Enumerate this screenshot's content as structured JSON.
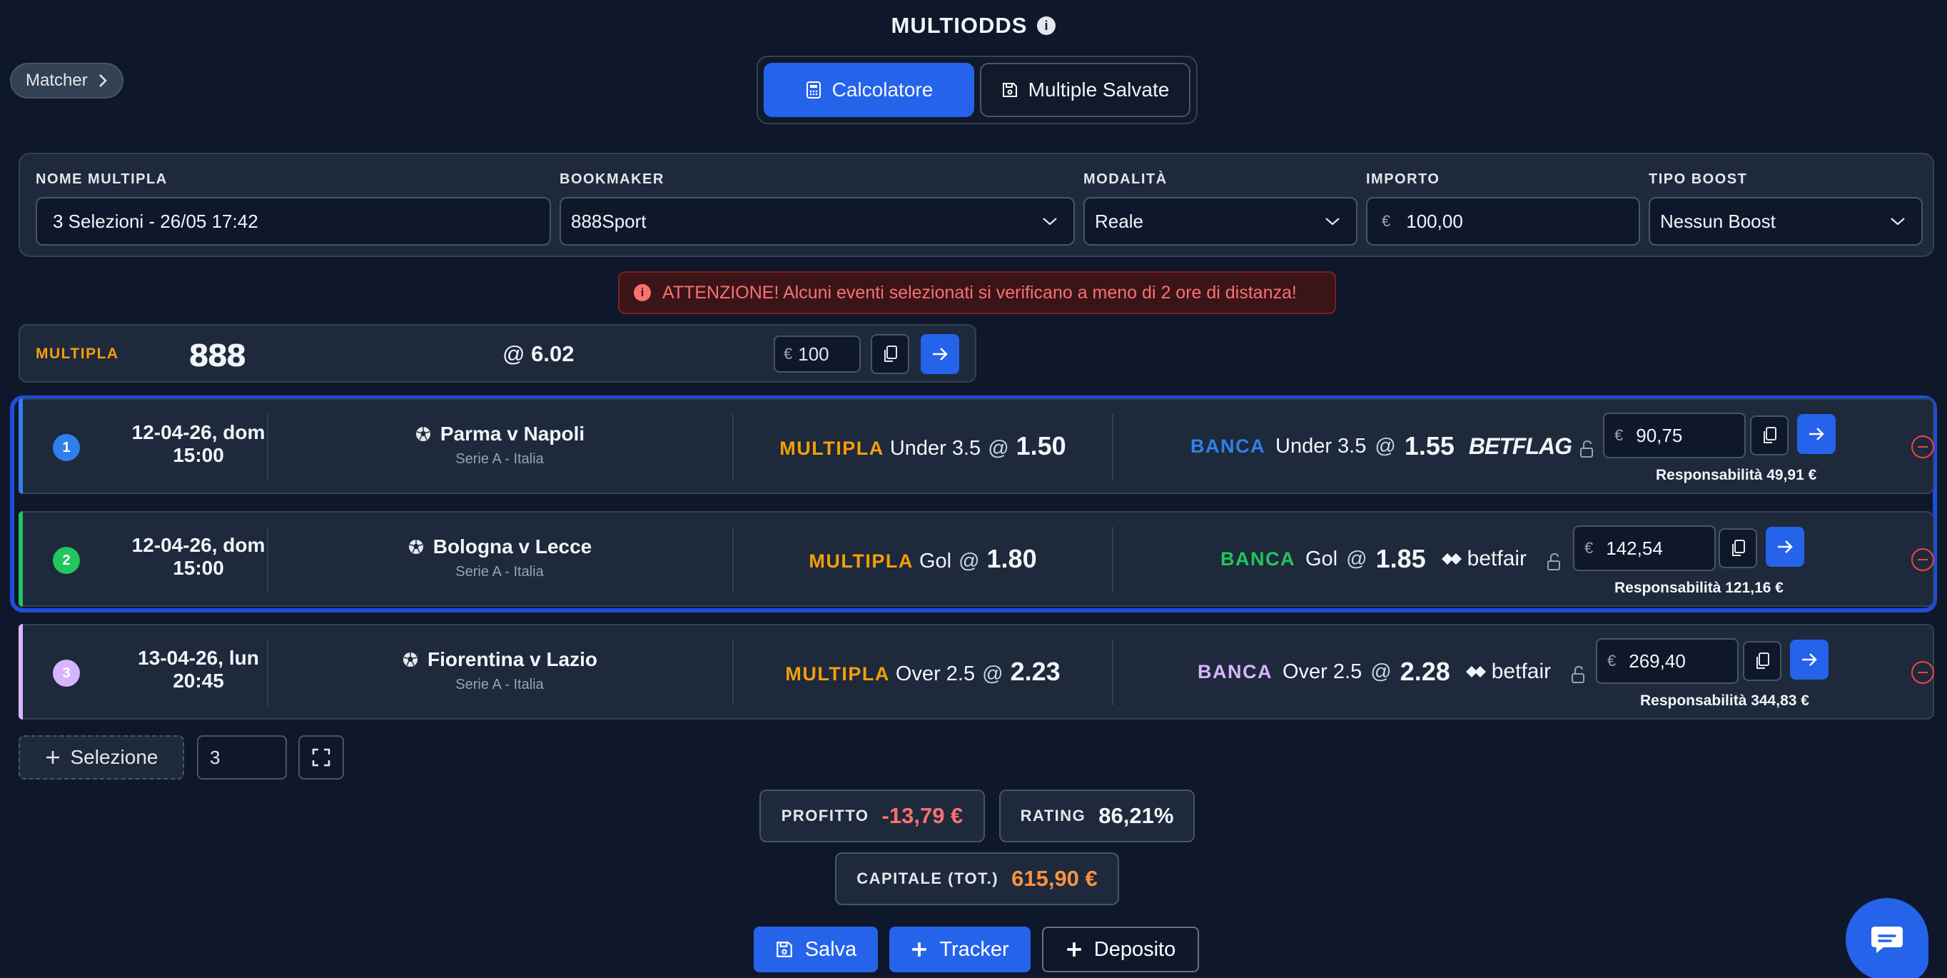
{
  "header": {
    "title": "MULTIODDS",
    "info_icon": "i"
  },
  "matcher": {
    "label": "Matcher"
  },
  "tabs": [
    {
      "label": "Calcolatore",
      "active": true
    },
    {
      "label": "Multiple Salvate",
      "active": false
    }
  ],
  "form": {
    "nome": {
      "label": "NOME MULTIPLA",
      "value": "3 Selezioni - 26/05 17:42"
    },
    "bookmaker": {
      "label": "BOOKMAKER",
      "value": "888Sport"
    },
    "modalita": {
      "label": "MODALITÀ",
      "value": "Reale"
    },
    "importo": {
      "label": "IMPORTO",
      "currency": "€",
      "value": "100,00"
    },
    "boost": {
      "label": "TIPO BOOST",
      "value": "Nessun Boost"
    }
  },
  "alert": {
    "text": "ATTENZIONE! Alcuni eventi selezionati si verificano a meno di 2 ore di distanza!"
  },
  "multipla": {
    "label": "MULTIPLA",
    "logo": "888",
    "at": "@",
    "odds": "6.02",
    "currency": "€",
    "stake": "100"
  },
  "selections": [
    {
      "num": "1",
      "date": "12-04-26, dom",
      "time": "15:00",
      "match": "Parma v Napoli",
      "league": "Serie A - Italia",
      "mult_label": "MULTIPLA",
      "market": "Under 3.5",
      "at": "@",
      "odds": "1.50",
      "bank_label": "BANCA",
      "bank_market": "Under 3.5",
      "bank_odds": "1.55",
      "exchange": "BETFLAG",
      "currency": "€",
      "stake": "90,75",
      "resp": "Responsabilità 49,91 €",
      "color": "#2f80ed"
    },
    {
      "num": "2",
      "date": "12-04-26, dom",
      "time": "15:00",
      "match": "Bologna v Lecce",
      "league": "Serie A - Italia",
      "mult_label": "MULTIPLA",
      "market": "Gol",
      "at": "@",
      "odds": "1.80",
      "bank_label": "BANCA",
      "bank_market": "Gol",
      "bank_odds": "1.85",
      "exchange": "betfair",
      "currency": "€",
      "stake": "142,54",
      "resp": "Responsabilità 121,16 €",
      "color": "#22c55e"
    },
    {
      "num": "3",
      "date": "13-04-26, lun",
      "time": "20:45",
      "match": "Fiorentina v Lazio",
      "league": "Serie A - Italia",
      "mult_label": "MULTIPLA",
      "market": "Over 2.5",
      "at": "@",
      "odds": "2.23",
      "bank_label": "BANCA",
      "bank_market": "Over 2.5",
      "bank_odds": "2.28",
      "exchange": "betfair",
      "currency": "€",
      "stake": "269,40",
      "resp": "Responsabilità 344,83 €",
      "color": "#d8b4fe"
    }
  ],
  "controls": {
    "add_label": "Selezione",
    "count": "3"
  },
  "stats": {
    "profitto": {
      "label": "PROFITTO",
      "value": "-13,79 €",
      "color": "#f87171"
    },
    "rating": {
      "label": "RATING",
      "value": "86,21%",
      "color": "#f1f5f9"
    },
    "capitale": {
      "label": "CAPITALE (TOT.)",
      "value": "615,90 €",
      "color": "#fb923c"
    }
  },
  "actions": {
    "salva": "Salva",
    "tracker": "Tracker",
    "deposito": "Deposito"
  },
  "colors": {
    "accent": "#2563eb",
    "multipla": "#f59e0b",
    "background": "#0f172a"
  }
}
